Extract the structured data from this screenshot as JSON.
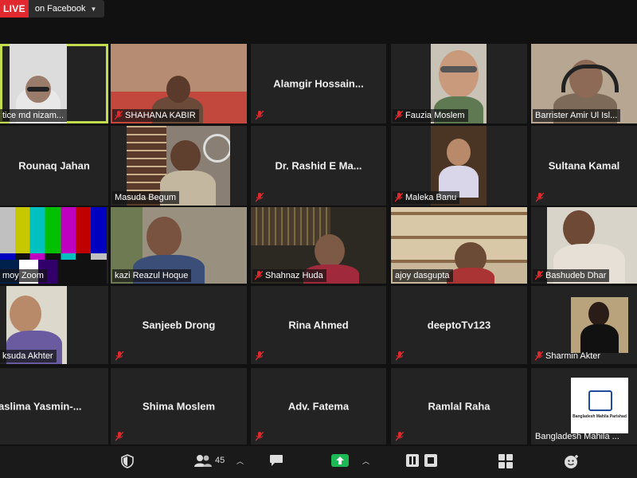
{
  "top": {
    "live": "LIVE",
    "live_target": "on Facebook"
  },
  "tiles": [
    {
      "name": "tice md nizam..."
    },
    {
      "name": "SHAHANA KABIR"
    },
    {
      "name": "Alamgir Hossain..."
    },
    {
      "name": "Fauzia Moslem"
    },
    {
      "name": "Barrister Amir Ul Isl..."
    },
    {
      "name": "Rounaq Jahan"
    },
    {
      "name": "Masuda Begum"
    },
    {
      "name": "Dr. Rashid E Ma..."
    },
    {
      "name": "Maleka Banu"
    },
    {
      "name": "Sultana Kamal"
    },
    {
      "name": "moy Zoom"
    },
    {
      "name": "kazi Reazul Hoque"
    },
    {
      "name": "Shahnaz Huda"
    },
    {
      "name": "ajoy dasgupta"
    },
    {
      "name": "Bashudeb Dhar"
    },
    {
      "name": "ksuda Akhter"
    },
    {
      "name": "Sanjeeb Drong"
    },
    {
      "name": "Rina Ahmed"
    },
    {
      "name": "deeptoTv123"
    },
    {
      "name": "Sharmin Akter"
    },
    {
      "name": "aslima Yasmin-..."
    },
    {
      "name": "Shima Moslem"
    },
    {
      "name": "Adv. Fatema"
    },
    {
      "name": "Ramlal Raha"
    },
    {
      "name": "Bangladesh Mahila ..."
    }
  ],
  "logo_text": "Bangladesh Mahila Parishad",
  "toolbar": {
    "participants_count": "45"
  },
  "colors": {
    "live": "#e0282e",
    "active_speaker": "#c3dc4f",
    "muted": "#e0282e",
    "share": "#1db954"
  }
}
